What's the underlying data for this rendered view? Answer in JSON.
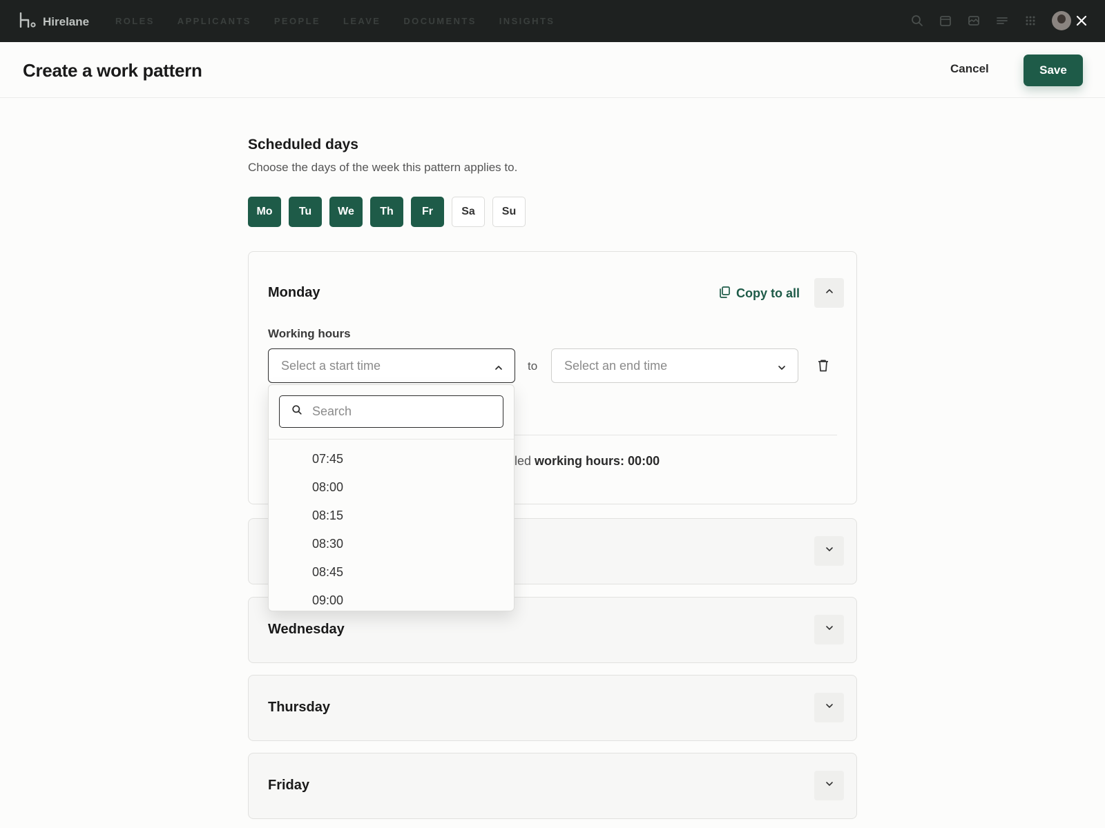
{
  "app": {
    "name": "Hirelane"
  },
  "nav": {
    "items": [
      "ROLES",
      "APPLICANTS",
      "PEOPLE",
      "LEAVE",
      "DOCUMENTS",
      "INSIGHTS"
    ]
  },
  "header": {
    "title": "Create a work pattern",
    "cancel_label": "Cancel",
    "save_label": "Save"
  },
  "scheduled_days": {
    "title": "Scheduled days",
    "subtitle": "Choose the days of the week this pattern applies to.",
    "days": [
      {
        "label": "Mo",
        "selected": true
      },
      {
        "label": "Tu",
        "selected": true
      },
      {
        "label": "We",
        "selected": true
      },
      {
        "label": "Th",
        "selected": true
      },
      {
        "label": "Fr",
        "selected": true
      },
      {
        "label": "Sa",
        "selected": false
      },
      {
        "label": "Su",
        "selected": false
      }
    ]
  },
  "monday": {
    "title": "Monday",
    "copy_to_all_label": "Copy to all",
    "working_hours_label": "Working hours",
    "start_placeholder": "Select a start time",
    "to_label": "to",
    "end_placeholder": "Select an end time",
    "total_prefix": "led",
    "total_label": "working hours: 00:00"
  },
  "dropdown": {
    "search_placeholder": "Search",
    "options": [
      "07:45",
      "08:00",
      "08:15",
      "08:30",
      "08:45",
      "09:00"
    ]
  },
  "collapsed_days": [
    {
      "title": ""
    },
    {
      "title": "Wednesday"
    },
    {
      "title": "Thursday"
    },
    {
      "title": "Friday"
    }
  ],
  "colors": {
    "accent": "#1e5b48",
    "nav_bg": "#1e2120"
  }
}
